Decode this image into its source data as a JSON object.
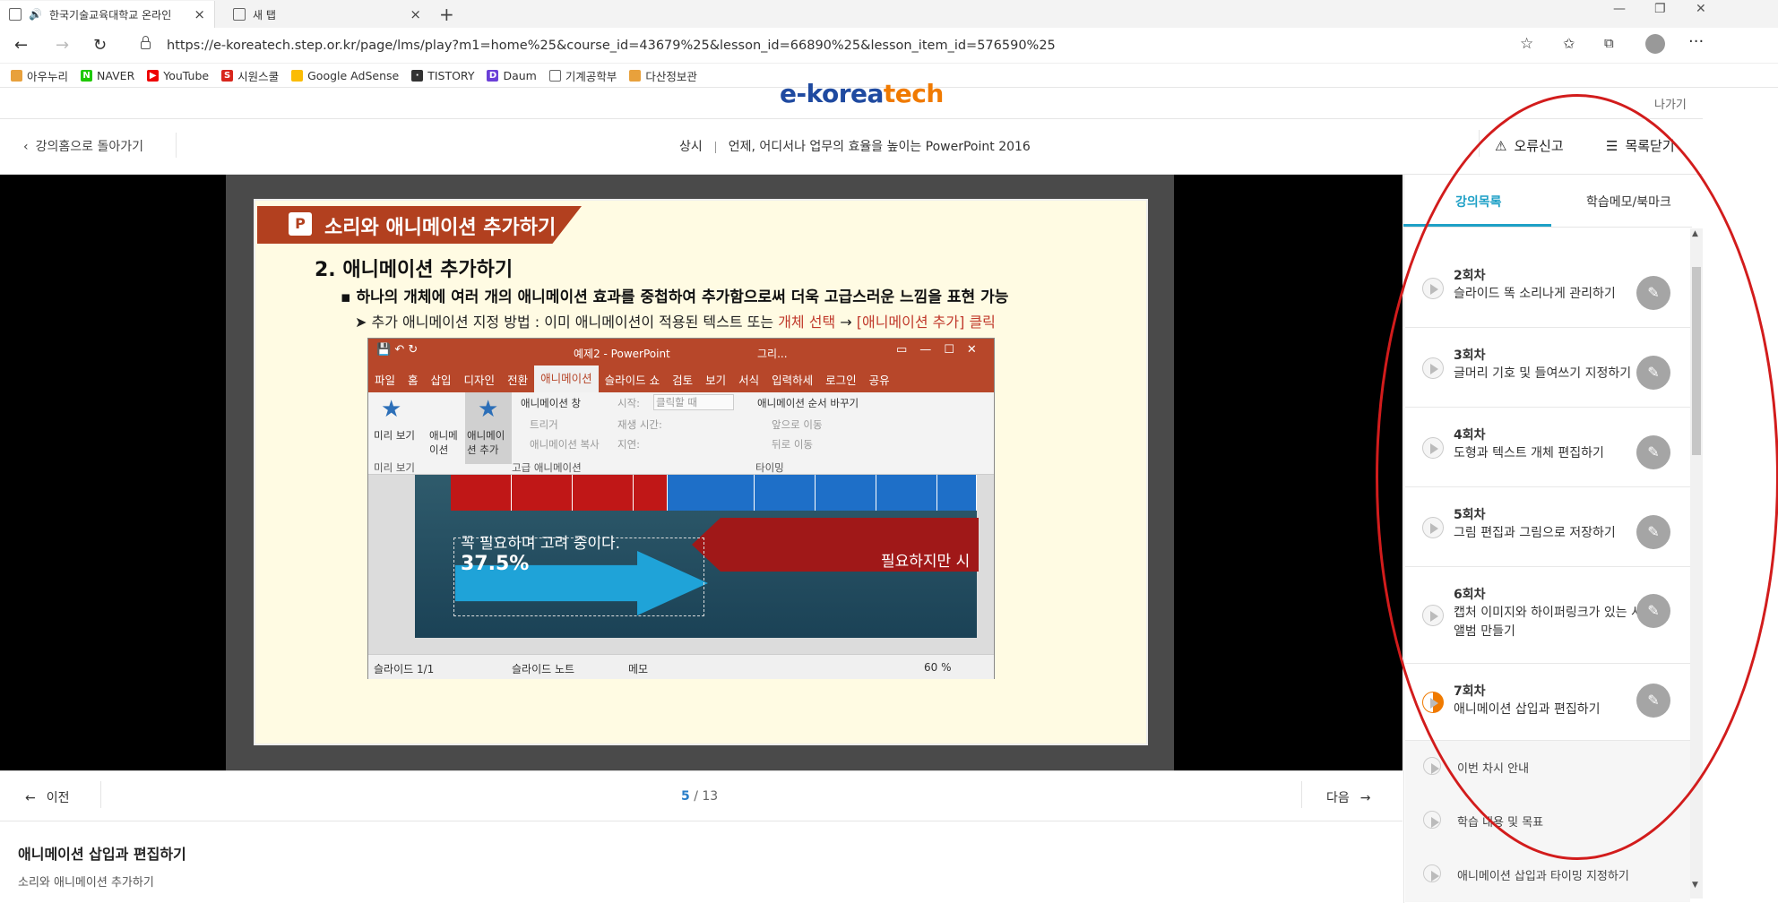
{
  "browser": {
    "active_tab": "한국기술교육대학교 온라인",
    "other_tab": "새 탭",
    "url": "https://e-koreatech.step.or.kr/page/lms/play?m1=home%25&course_id=43679%25&lesson_id=66890%25&lesson_item_id=576590%25",
    "bookmarks": [
      "아우누리",
      "NAVER",
      "YouTube",
      "시원스쿨",
      "Google AdSense",
      "TISTORY",
      "Daum",
      "기계공학부",
      "다산정보관"
    ]
  },
  "header": {
    "logo_main": "e-korea",
    "logo_accent": "tech",
    "exit": "나가기",
    "back": "강의홈으로 돌아가기",
    "category": "상시",
    "course_title": "언제, 어디서나 업무의 효율을 높이는 PowerPoint 2016",
    "report": "오류신고",
    "close_list": "목록닫기"
  },
  "slide": {
    "title": "소리와 애니메이션 추가하기",
    "heading": "2. 애니메이션 추가하기",
    "bullet": "하나의 개체에 여러 개의 애니메이션 효과를 중첩하여 추가함으로써 더욱 고급스러운 느낌을 표현 가능",
    "sub_prefix": "추가 애니메이션 지정 방법 : 이미 애니메이션이 적용된 텍스트 또는 ",
    "sub_red1": "개체 선택",
    "sub_arrow": " → ",
    "sub_red2": "[애니메이션 추가] 클릭"
  },
  "ppt": {
    "title": "예제2 - PowerPoint",
    "title_extra": "그리...",
    "tabs": [
      "파일",
      "홈",
      "삽입",
      "디자인",
      "전환",
      "애니메이션",
      "슬라이드 쇼",
      "검토",
      "보기",
      "서식",
      "입력하세",
      "로그인",
      "공유"
    ],
    "ribbon": {
      "preview": "미리 보기",
      "animation": "애니메이션",
      "add_animation": "애니메이션 추가",
      "pane": "애니메이션 창",
      "trigger": "트리거",
      "painter": "애니메이션 복사",
      "start": "시작:",
      "start_val": "클릭할 때",
      "duration": "재생 시간:",
      "delay": "지연:",
      "reorder": "애니메이션 순서 바꾸기",
      "move_earlier": "앞으로 이동",
      "move_later": "뒤로 이동",
      "grp_preview": "미리 보기",
      "grp_adv": "고급 애니메이션",
      "grp_timing": "타이밍"
    },
    "slide_text1": "꼭 필요하며 고려 중이다.",
    "slide_pct": "37.5%",
    "slide_text2": "필요하지만 시",
    "status_slide": "슬라이드 1/1",
    "status_notes": "슬라이드 노트",
    "status_comments": "메모",
    "zoom": "60 %"
  },
  "player": {
    "prev": "이전",
    "next": "다음",
    "page_current": "5",
    "page_total": " / 13",
    "lesson_title": "애니메이션 삽입과 편집하기",
    "lesson_sub": "소리와 애니메이션 추가하기"
  },
  "sidebar": {
    "tab_list": "강의목록",
    "tab_memo": "학습메모/북마크",
    "lessons": [
      {
        "num": "2회차",
        "name": "슬라이드 똑 소리나게 관리하기"
      },
      {
        "num": "3회차",
        "name": "글머리 기호 및 들여쓰기 지정하기"
      },
      {
        "num": "4회차",
        "name": "도형과 텍스트 개체 편집하기"
      },
      {
        "num": "5회차",
        "name": "그림 편집과 그림으로 저장하기"
      },
      {
        "num": "6회차",
        "name": "캡처 이미지와 하이퍼링크가 있는 사진 앨범 만들기"
      },
      {
        "num": "7회차",
        "name": "애니메이션 삽입과 편집하기"
      }
    ],
    "subitems": [
      "이번 차시 안내",
      "학습 내용 및 목표",
      "애니메이션 삽입과 타이밍 지정하기"
    ]
  },
  "colors": {
    "accent": "#1ea0c6",
    "slide_title_bg": "#b2401f",
    "annotation": "#d21c1c",
    "ppt_red": "#b7472a"
  }
}
